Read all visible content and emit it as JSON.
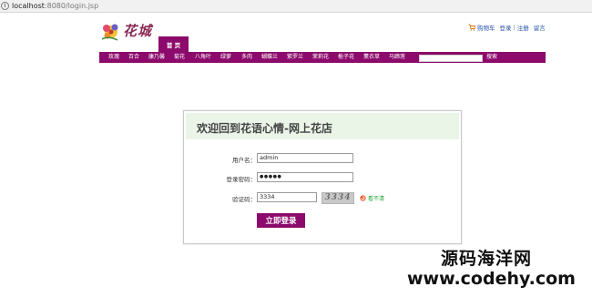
{
  "browser": {
    "url_host": "localhost",
    "url_rest": ":8080/login.jsp"
  },
  "header": {
    "logo_text": "花城",
    "links": {
      "cart": "购物车",
      "login": "登录",
      "separator": "|",
      "register": "注册",
      "message": "留言"
    },
    "home_tab": "首 页"
  },
  "nav": {
    "items": [
      "玫瑰",
      "百合",
      "康乃馨",
      "菊花",
      "八角叶",
      "绿萝",
      "多肉",
      "蝴蝶兰",
      "紫罗兰",
      "茉莉花",
      "栀子花",
      "薰衣草",
      "马蹄莲"
    ],
    "search_value": "",
    "search_label": "搜索"
  },
  "login": {
    "title": "欢迎回到花语心情-网上花店",
    "username_label": "用户名：",
    "username_value": "admin",
    "password_label": "登录密码：",
    "password_value": "●●●●●",
    "captcha_label": "验证码：",
    "captcha_value": "3334",
    "captcha_image_text": "3334",
    "refresh_text": "看不清",
    "submit_label": "立即登录"
  },
  "watermark": {
    "line1": "源码海洋网",
    "line2": "www.codehy.com"
  },
  "colors": {
    "brand": "#8c0a6b",
    "panel_head": "#eaf5e8",
    "link": "#2a56a8"
  }
}
